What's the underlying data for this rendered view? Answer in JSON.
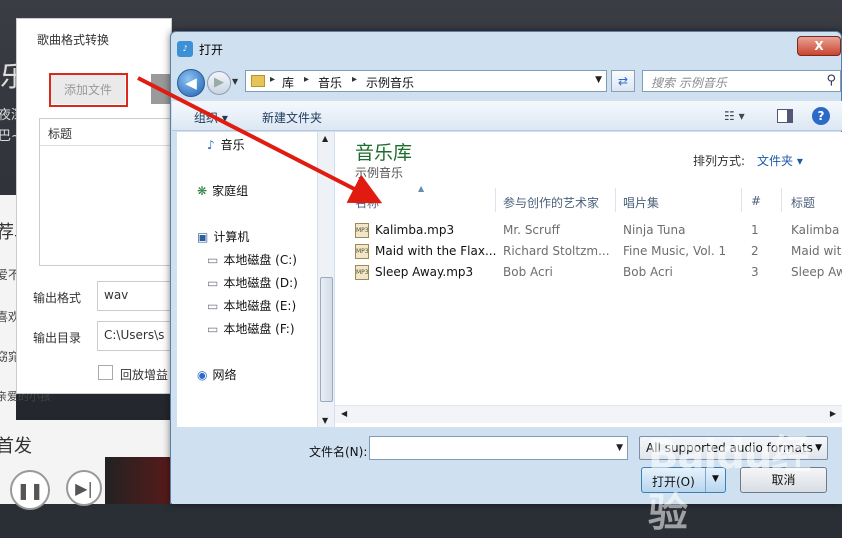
{
  "background_app": {
    "left_texts": [
      "乐",
      "夜深",
      "巴~",
      "荐单",
      "爱不",
      "喜欢",
      "窈窕",
      "亲爱的小孩",
      "首发"
    ]
  },
  "converter": {
    "title": "歌曲格式转换",
    "add_file_label": "添加文件",
    "file_list_header": "标题",
    "output_format_label": "输出格式",
    "output_format_value": "wav",
    "output_dir_label": "输出目录",
    "output_dir_value": "C:\\Users\\s",
    "replay_gain_label": "回放增益"
  },
  "open_dialog": {
    "title": "打开",
    "close_label": "X",
    "address": [
      "库",
      "音乐",
      "示例音乐"
    ],
    "search_placeholder": "搜索 示例音乐",
    "toolbar": {
      "organize": "组织 ▾",
      "new_folder": "新建文件夹"
    },
    "nav": {
      "music": "音乐",
      "homegroup": "家庭组",
      "computer": "计算机",
      "drives": [
        "本地磁盘 (C:)",
        "本地磁盘 (D:)",
        "本地磁盘 (E:)",
        "本地磁盘 (F:)"
      ],
      "network": "网络"
    },
    "library_title": "音乐库",
    "library_subtitle": "示例音乐",
    "arrange_label": "排列方式:",
    "arrange_value": "文件夹 ▾",
    "columns": [
      "名称",
      "参与创作的艺术家",
      "唱片集",
      "#",
      "标题"
    ],
    "files": [
      {
        "name": "Kalimba.mp3",
        "artist": "Mr. Scruff",
        "album": "Ninja Tuna",
        "track": "1",
        "title": "Kalimba"
      },
      {
        "name": "Maid with the Flax...",
        "artist": "Richard Stoltzm...",
        "album": "Fine Music, Vol. 1",
        "track": "2",
        "title": "Maid wit"
      },
      {
        "name": "Sleep Away.mp3",
        "artist": "Bob Acri",
        "album": "Bob Acri",
        "track": "3",
        "title": "Sleep Aw"
      }
    ],
    "filename_label": "文件名(N):",
    "filename_value": "",
    "filetype_value": "All supported audio formats",
    "open_label": "打开(O)",
    "cancel_label": "取消"
  },
  "watermark": "Baidu经验"
}
